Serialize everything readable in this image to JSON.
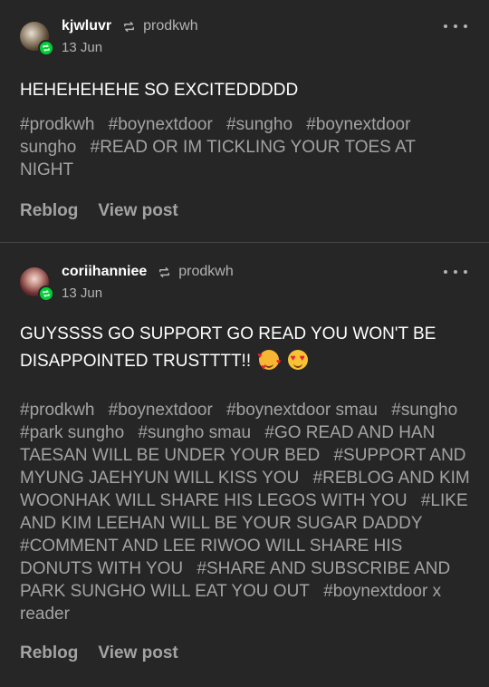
{
  "posts": [
    {
      "username": "kjwluvr",
      "source": "prodkwh",
      "date": "13 Jun",
      "body": "HEHEHEHEHE SO EXCITEDDDDD",
      "tags": [
        "#prodkwh",
        "#boynextdoor",
        "#sungho",
        "#boynextdoor sungho",
        "#READ OR IM TICKLING YOUR TOES AT NIGHT"
      ],
      "actions": {
        "reblog": "Reblog",
        "view_post": "View post"
      }
    },
    {
      "username": "coriihanniee",
      "source": "prodkwh",
      "date": "13 Jun",
      "body": "GUYSSSS GO SUPPORT GO READ YOU WON'T BE DISAPPOINTED TRUSTTTT!!",
      "emojis": [
        "smiling-face-with-hearts",
        "heart-eyes"
      ],
      "tags": [
        "#prodkwh",
        "#boynextdoor",
        "#boynextdoor smau",
        "#sungho",
        "#park sungho",
        "#sungho smau",
        "#GO READ AND HAN TAESAN WILL BE UNDER YOUR BED",
        "#SUPPORT AND MYUNG JAEHYUN WILL KISS YOU",
        "#REBLOG AND KIM WOONHAK WILL SHARE HIS LEGOS WITH YOU",
        "#LIKE AND KIM LEEHAN WILL BE YOUR SUGAR DADDY",
        "#COMMENT AND LEE RIWOO WILL SHARE HIS DONUTS WITH YOU",
        "#SHARE AND SUBSCRIBE AND PARK SUNGHO WILL EAT YOU OUT",
        "#boynextdoor x reader"
      ],
      "actions": {
        "reblog": "Reblog",
        "view_post": "View post"
      }
    }
  ],
  "colors": {
    "background": "#262626",
    "reblog_badge": "#00cf35",
    "muted_text": "#a3a3a3"
  }
}
